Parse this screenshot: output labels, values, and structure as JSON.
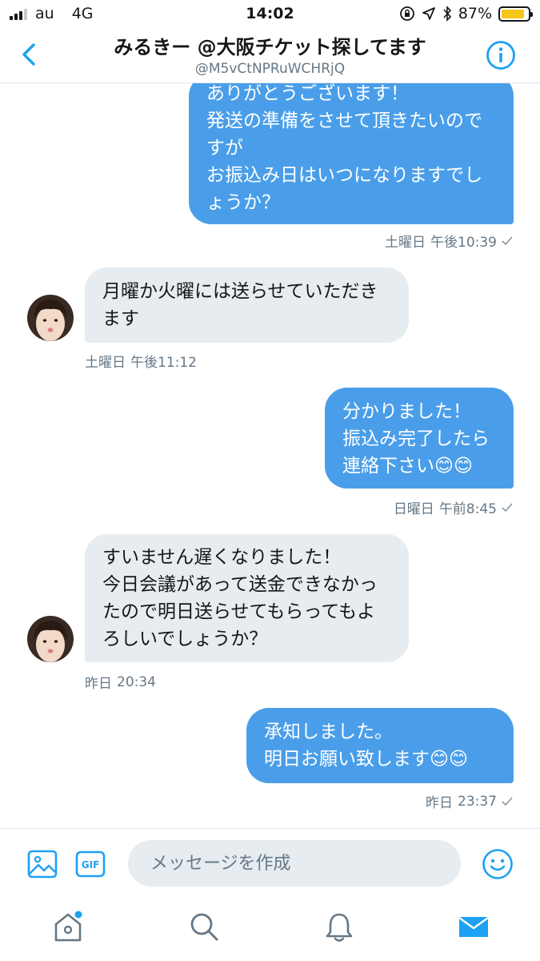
{
  "status_bar": {
    "carrier": "au",
    "network": "4G",
    "time": "14:02",
    "battery_percent": "87%",
    "battery_level": 0.87,
    "battery_color": "#f5c518"
  },
  "header": {
    "title": "みるきー @大阪チケット探してます",
    "handle": "@M5vCtNPRuWCHRjQ",
    "back_icon": "chevron-left-icon",
    "info_icon": "info-circle-icon"
  },
  "colors": {
    "accent": "#1da1f2",
    "sent_bubble": "#4a9ee9",
    "received_bubble": "#e6ecf0"
  },
  "messages": [
    {
      "direction": "sent",
      "lines": [
        "ありがとうございます！",
        "発送の準備をさせて頂きたいので",
        "すが",
        "お振込み日はいつになりますでし",
        "ょうか？"
      ],
      "day": "土曜日",
      "time": "午後10:39",
      "read_icon": "checkmark-icon"
    },
    {
      "direction": "received",
      "lines": [
        "月曜か火曜には送らせていただき",
        "ます"
      ],
      "day": "土曜日",
      "time": "午後11:12"
    },
    {
      "direction": "sent",
      "lines": [
        "分かりました！",
        "振込み完了したら",
        "連絡下さい😊😊"
      ],
      "day": "日曜日",
      "time": "午前8:45",
      "read_icon": "checkmark-icon"
    },
    {
      "direction": "received",
      "lines": [
        "すいません遅くなりました！",
        "今日会議があって送金できなかっ",
        "たので明日送らせてもらってもよ",
        "ろしいでしょうか？"
      ],
      "day": "昨日",
      "time": "20:34"
    },
    {
      "direction": "sent",
      "lines": [
        "承知しました。",
        "明日お願い致します😊😊"
      ],
      "day": "昨日",
      "time": "23:37",
      "read_icon": "checkmark-icon"
    }
  ],
  "composer": {
    "placeholder": "メッセージを作成",
    "gif_label": "GIF",
    "image_icon": "image-icon",
    "emoji_icon": "smiley-icon"
  },
  "tab_bar": {
    "tabs": [
      "home-icon",
      "search-icon",
      "notifications-bell-icon",
      "messages-envelope-icon"
    ],
    "active_tab": "messages-envelope-icon"
  }
}
